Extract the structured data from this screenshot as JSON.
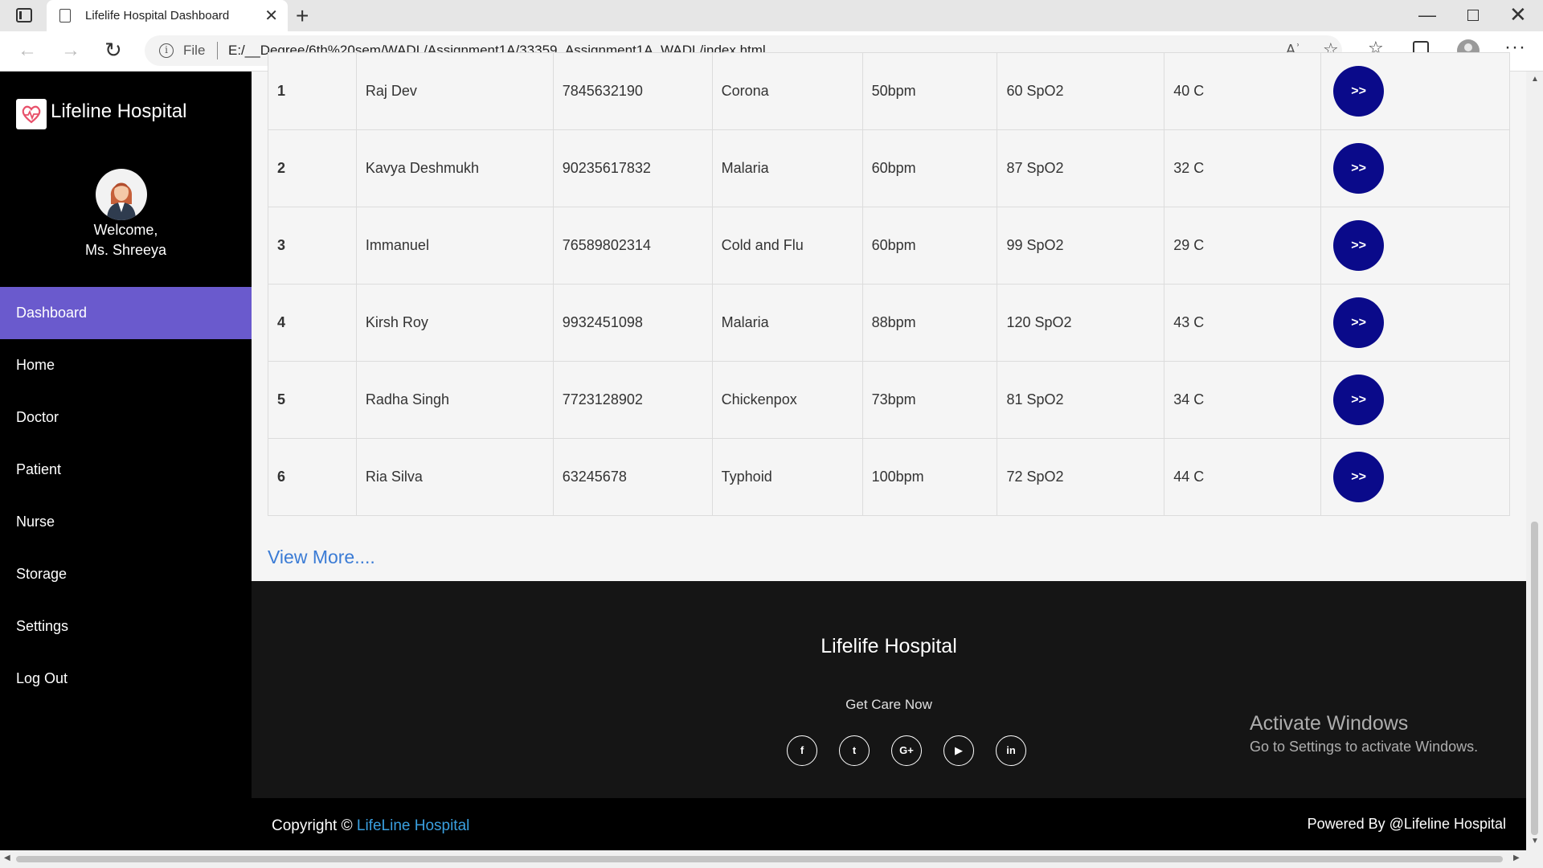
{
  "browser": {
    "tab_title": "Lifelife Hospital Dashboard",
    "tab_close": "✕",
    "new_tab": "+",
    "address_prefix": "File",
    "url": "E:/__Degree/6th%20sem/WADL/Assignment1A/33359_Assignment1A_WADL/index.html",
    "read_aloud": "Aʾ",
    "minimize": "—",
    "close": "✕"
  },
  "sidebar": {
    "brand": "Lifeline Hospital",
    "welcome_line1": "Welcome,",
    "welcome_line2": "Ms. Shreeya",
    "menu": [
      {
        "label": "Dashboard",
        "active": true
      },
      {
        "label": "Home"
      },
      {
        "label": "Doctor"
      },
      {
        "label": "Patient"
      },
      {
        "label": "Nurse"
      },
      {
        "label": "Storage"
      },
      {
        "label": "Settings"
      },
      {
        "label": "Log Out"
      }
    ]
  },
  "patients": {
    "action_label": ">>",
    "rows": [
      {
        "no": "1",
        "name": "Raj Dev",
        "phone": "7845632190",
        "disease": "Corona",
        "pulse": "50bpm",
        "spo2": "60 SpO2",
        "temp": "40 C"
      },
      {
        "no": "2",
        "name": "Kavya Deshmukh",
        "phone": "90235617832",
        "disease": "Malaria",
        "pulse": "60bpm",
        "spo2": "87 SpO2",
        "temp": "32 C"
      },
      {
        "no": "3",
        "name": "Immanuel",
        "phone": "76589802314",
        "disease": "Cold and Flu",
        "pulse": "60bpm",
        "spo2": "99 SpO2",
        "temp": "29 C"
      },
      {
        "no": "4",
        "name": "Kirsh Roy",
        "phone": "9932451098",
        "disease": "Malaria",
        "pulse": "88bpm",
        "spo2": "120 SpO2",
        "temp": "43 C"
      },
      {
        "no": "5",
        "name": "Radha Singh",
        "phone": "7723128902",
        "disease": "Chickenpox",
        "pulse": "73bpm",
        "spo2": "81 SpO2",
        "temp": "34 C"
      },
      {
        "no": "6",
        "name": "Ria Silva",
        "phone": "63245678",
        "disease": "Typhoid",
        "pulse": "100bpm",
        "spo2": "72 SpO2",
        "temp": "44 C"
      }
    ],
    "view_more": "View More...."
  },
  "footer": {
    "title": "Lifelife Hospital",
    "tagline": "Get Care Now",
    "socials": [
      {
        "icon": "facebook-icon",
        "glyph": "f"
      },
      {
        "icon": "twitter-icon",
        "glyph": "t"
      },
      {
        "icon": "google-plus-icon",
        "glyph": "G+"
      },
      {
        "icon": "youtube-icon",
        "glyph": "▶"
      },
      {
        "icon": "linkedin-icon",
        "glyph": "in"
      }
    ],
    "copyright_prefix": "Copyright ©",
    "copyright_brand": "LifeLine Hospital",
    "powered_by": "Powered By @Lifeline Hospital"
  },
  "os_watermark": {
    "title": "Activate Windows",
    "subtitle": "Go to Settings to activate Windows."
  },
  "colors": {
    "sidebar_bg": "#000000",
    "active_menu": "#6a5acd",
    "action_button": "#0a0a8a",
    "link": "#3a7bd5",
    "footer_bg": "#151515"
  }
}
